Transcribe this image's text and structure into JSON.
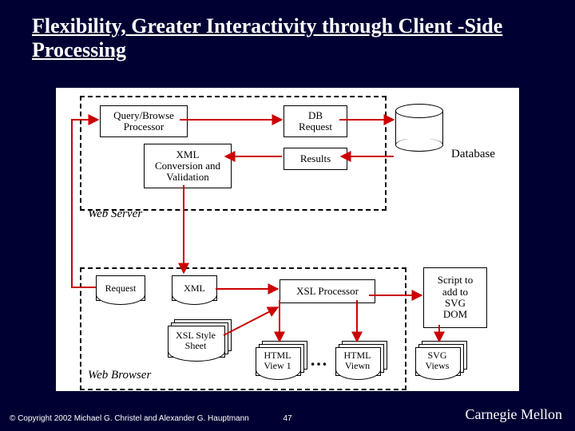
{
  "slide": {
    "title": "Flexibility, Greater Interactivity through Client -Side Processing",
    "page_number": "47",
    "copyright": "© Copyright 2002 Michael G. Christel and Alexander G. Hauptmann",
    "university": "Carnegie Mellon"
  },
  "diagram": {
    "web_server_label": "Web Server",
    "web_browser_label": "Web Browser",
    "query_browse": "Query/Browse\nProcessor",
    "xml_conv": "XML\nConversion and\nValidation",
    "db_request": "DB\nRequest",
    "results": "Results",
    "database": "Database",
    "request": "Request",
    "xml": "XML",
    "xsl_processor": "XSL Processor",
    "xsl_style_sheet": "XSL Style\nSheet",
    "html_view1": "HTML\nView 1",
    "html_viewn": "HTML\nViewn",
    "svg_views": "SVG\nViews",
    "script_box": "Script to\nadd to\nSVG\nDOM",
    "ellipsis": "…"
  }
}
